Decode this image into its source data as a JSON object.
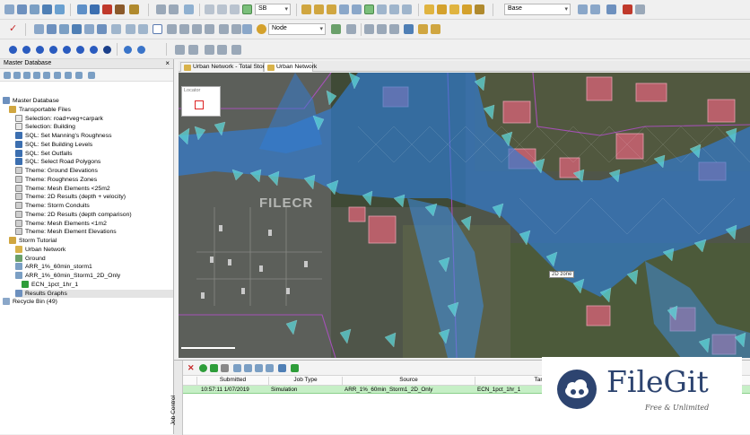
{
  "toolbar": {
    "selection_combo_value": "SB",
    "select_mode_combo_value": "Node",
    "layer_combo_value": "Base"
  },
  "left_panel": {
    "title": "Master Database",
    "tree": [
      {
        "label": "Master Database",
        "indent": 0,
        "icon": "database-icon"
      },
      {
        "label": "Transportable Files",
        "indent": 1,
        "icon": "folder-icon"
      },
      {
        "label": "Selection: road+veg+carpark",
        "indent": 2,
        "icon": "selection-icon"
      },
      {
        "label": "Selection: Building",
        "indent": 2,
        "icon": "selection-icon"
      },
      {
        "label": "SQL: Set Manning's Roughness",
        "indent": 2,
        "icon": "sql-icon"
      },
      {
        "label": "SQL: Set Building Levels",
        "indent": 2,
        "icon": "sql-icon"
      },
      {
        "label": "SQL: Set Outfalls",
        "indent": 2,
        "icon": "sql-icon"
      },
      {
        "label": "SQL: Select Road Polygons",
        "indent": 2,
        "icon": "sql-icon"
      },
      {
        "label": "Theme: Ground Elevations",
        "indent": 2,
        "icon": "theme-icon"
      },
      {
        "label": "Theme: Roughness Zones",
        "indent": 2,
        "icon": "theme-icon"
      },
      {
        "label": "Theme: Mesh Elements <25m2",
        "indent": 2,
        "icon": "theme-icon"
      },
      {
        "label": "Theme: 2D Results (depth + velocity)",
        "indent": 2,
        "icon": "theme-icon"
      },
      {
        "label": "Theme: Storm Conduits",
        "indent": 2,
        "icon": "theme-icon"
      },
      {
        "label": "Theme: 2D Results (depth comparison)",
        "indent": 2,
        "icon": "theme-icon"
      },
      {
        "label": "Theme: Mesh Elements <1m2",
        "indent": 2,
        "icon": "theme-icon"
      },
      {
        "label": "Theme: Mesh Element Elevations",
        "indent": 2,
        "icon": "theme-icon"
      },
      {
        "label": "Storm Tutorial",
        "indent": 1,
        "icon": "folder-icon"
      },
      {
        "label": "Urban Network",
        "indent": 2,
        "icon": "network-icon"
      },
      {
        "label": "Ground",
        "indent": 2,
        "icon": "ground-icon"
      },
      {
        "label": "ARR_1%_60min_storm1",
        "indent": 2,
        "icon": "run-icon"
      },
      {
        "label": "ARR_1%_60min_Storm1_2D_Only",
        "indent": 2,
        "icon": "run-icon"
      },
      {
        "label": "ECN_1pct_1hr_1",
        "indent": 3,
        "icon": "sim-icon"
      },
      {
        "label": "Results Graphs",
        "indent": 2,
        "icon": "graph-icon",
        "selected": true
      },
      {
        "label": "Recycle Bin (49)",
        "indent": 0,
        "icon": "recycle-bin-icon"
      }
    ]
  },
  "map_tabs": [
    {
      "label": "Urban Network - Total Storage"
    },
    {
      "label": "Urban Network"
    }
  ],
  "map": {
    "locator_title": "Locator",
    "tooltip": "2D zone",
    "watermark": "FILECR"
  },
  "job_control": {
    "panel_label": "Job Control",
    "columns": [
      "Submitted",
      "Job Type",
      "Source",
      "Target"
    ],
    "rows": [
      {
        "submitted": "10:57:11 1/07/2019",
        "job_type": "Simulation",
        "source": "ARR_1%_60min_Storm1_2D_Only",
        "target": "ECN_1pct_1hr_1"
      }
    ]
  },
  "watermark": {
    "title": "FileGit",
    "tagline": "Free & Unlimited"
  }
}
